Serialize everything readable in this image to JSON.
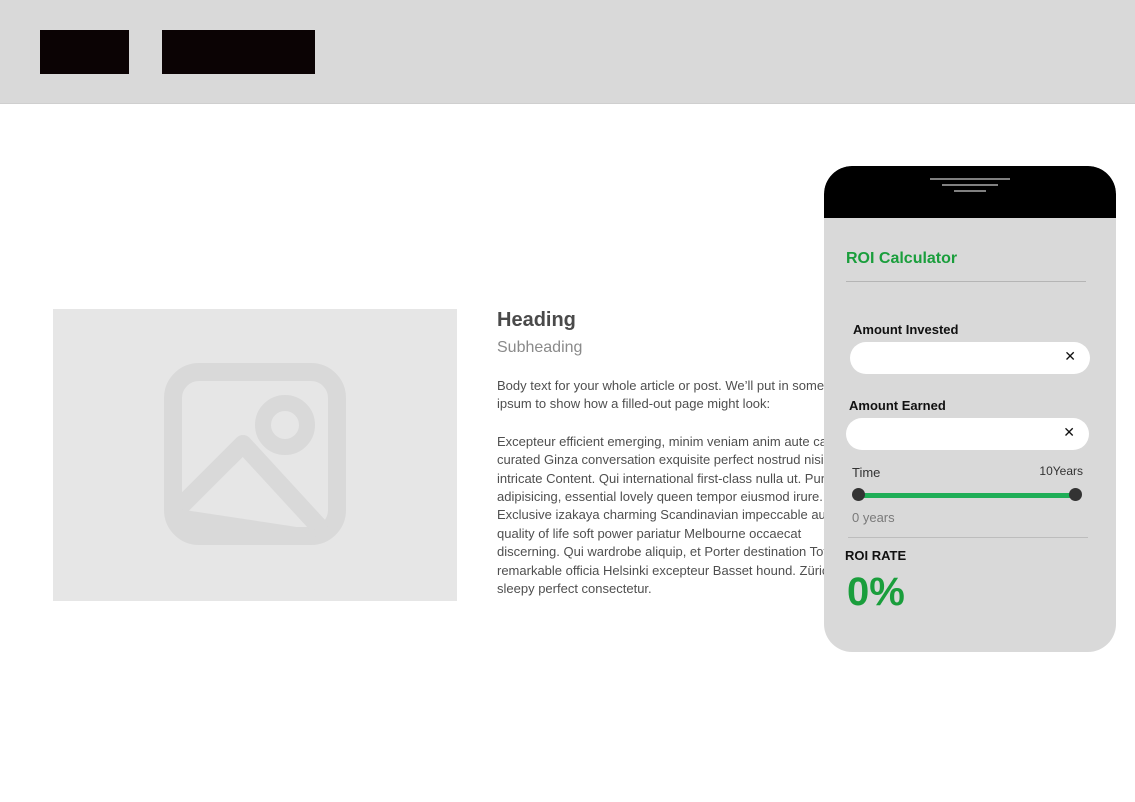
{
  "article": {
    "heading": "Heading",
    "subheading": "Subheading",
    "paragraph1_lines": [
      "Body text for your whole article or post. We’ll put in some lorem",
      "ipsum to show how a filled-out page might look:"
    ],
    "paragraph2_lines": [
      "Excepteur efficient emerging, minim veniam anim aute carefully",
      "curated Ginza conversation exquisite perfect nostrud nisi",
      "intricate Content. Qui  international first-class nulla ut. Punctual",
      "adipisicing, essential lovely queen tempor eiusmod irure.",
      "Exclusive izakaya charming Scandinavian impeccable aute",
      "quality of life soft power pariatur Melbourne occaecat",
      "discerning. Qui wardrobe aliquip, et Porter destination Toto",
      "remarkable officia Helsinki excepteur Basset hound. Zürich",
      "sleepy perfect consectetur."
    ]
  },
  "roi": {
    "title": "ROI Calculator",
    "amount_invested_label": "Amount Invested",
    "amount_invested_value": "",
    "amount_earned_label": "Amount Earned",
    "amount_earned_value": "",
    "clear_glyph": "✕",
    "time_label": "Time",
    "time_max_label": "10Years",
    "time_min_label": "0 years",
    "time_range_years": [
      0,
      10
    ],
    "roi_rate_label": "ROI RATE",
    "roi_rate_value": "0%"
  },
  "colors": {
    "accent_green": "#1a9e3c",
    "slider_green": "#1fae57",
    "topbar_gray": "#d9d9d9",
    "block_black": "#0b0304"
  },
  "icons": {
    "image_placeholder": "image-placeholder-icon",
    "clear": "close-icon"
  }
}
